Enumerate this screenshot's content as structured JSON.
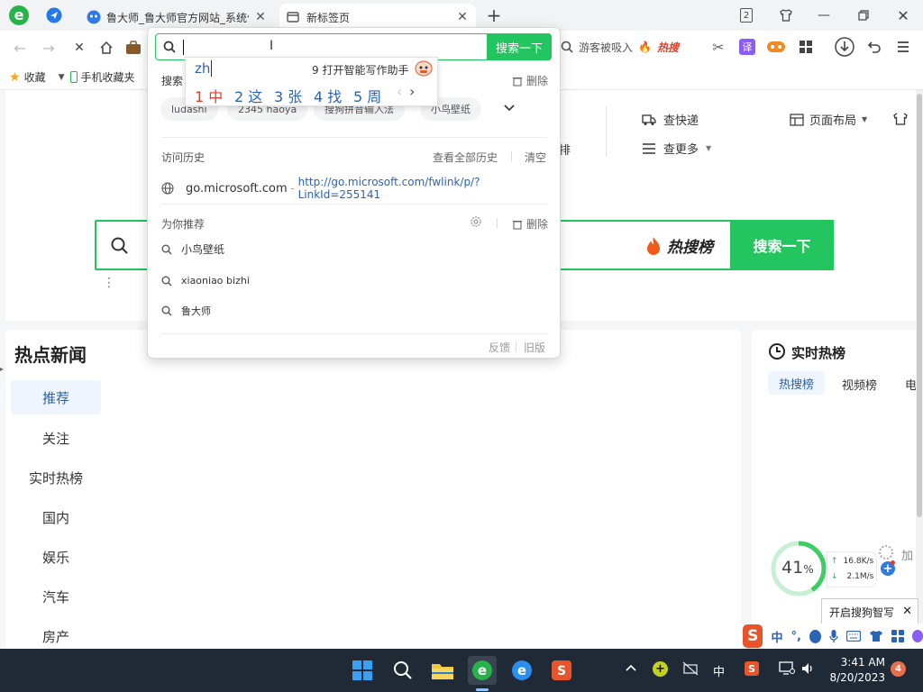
{
  "tabs": [
    {
      "title": "鲁大师_鲁大师官方网站_系统优化",
      "active": false
    },
    {
      "title": "新标签页",
      "active": true
    }
  ],
  "tab_count": "2",
  "toolbar": {
    "right_search_placeholder": "游客被吸入",
    "hot_search_label": "热搜"
  },
  "bookmarks": {
    "favorites_label": "收藏",
    "mobile_label": "手机收藏夹"
  },
  "header_links": {
    "kuaidi": "查快递",
    "more": "查更多",
    "layout": "页面布局",
    "partial_char": "排"
  },
  "big_search": {
    "hot_rank": "热搜榜",
    "button": "搜索一下"
  },
  "left_panel": {
    "title": "热点新闻",
    "nav": [
      "推荐",
      "关注",
      "实时热榜",
      "国内",
      "娱乐",
      "汽车",
      "房产"
    ]
  },
  "right_panel": {
    "title": "实时热榜",
    "tabs": [
      "热搜榜",
      "视频榜",
      "电"
    ]
  },
  "dropdown": {
    "search_button": "搜索一下",
    "search_history_label": "搜索",
    "delete_label": "删除",
    "chips": [
      "ludashi",
      "2345 haoya",
      "搜狗拼音输入法",
      "小鸟壁纸"
    ],
    "history_title": "访问历史",
    "view_all_history": "查看全部历史",
    "clear": "清空",
    "history_site": "go.microsoft.com",
    "history_sep": " - ",
    "history_url": "http://go.microsoft.com/fwlink/p/?LinkId=255141",
    "recommend_title": "为你推荐",
    "recommend_delete": "删除",
    "recommendations": [
      "小鸟壁纸",
      "xiaoniao bizhi",
      "鲁大师"
    ],
    "feedback": "反馈",
    "old_version": "旧版"
  },
  "ime": {
    "composition": "zh",
    "assistant": "9 打开智能写作助手",
    "candidates": [
      "1 中",
      "2 这",
      "3 张",
      "4 找",
      "5 周"
    ],
    "prev": "‹",
    "next": "›"
  },
  "widgets": {
    "cpu_percent": "41",
    "percent_sign": "%",
    "up_speed": "16.8K/s",
    "down_speed": "2.1M/s",
    "accel_label": "加",
    "sogou_hint": "开启搜狗智写",
    "ime_bar_lang": "中",
    "ime_bar_punct": "°,"
  },
  "taskbar": {
    "lang": "中",
    "time": "3:41 AM",
    "date": "8/20/2023",
    "notification_count": "4"
  },
  "colors": {
    "accent_green": "#22c55e",
    "link_blue": "#2a64b7",
    "hot_red": "#e23b26",
    "taskbar": "#202a36"
  }
}
